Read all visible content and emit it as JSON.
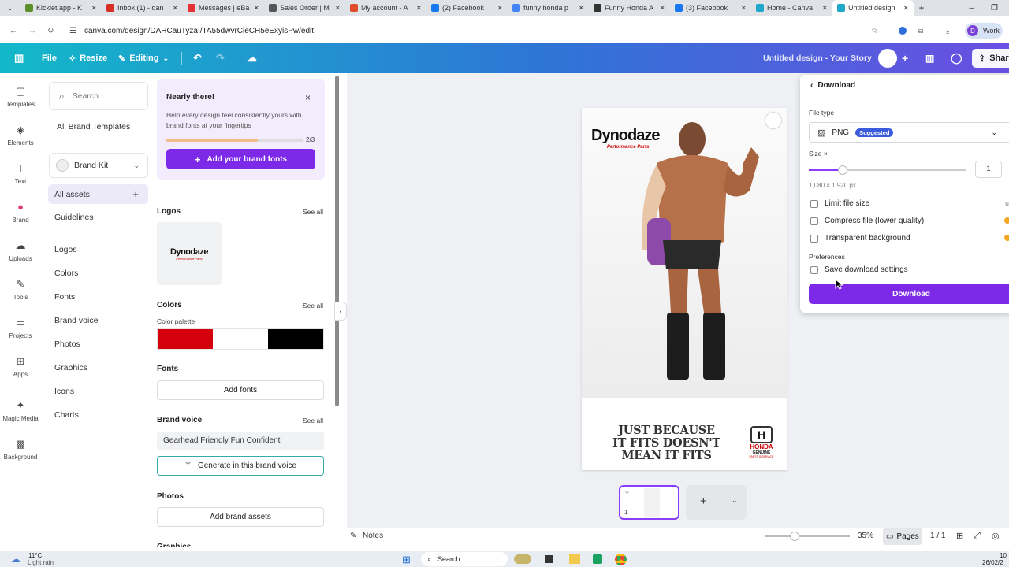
{
  "browser": {
    "tabs": [
      {
        "title": "Kicklet.app - K",
        "icon": "kicklet-icon",
        "color": "#5a8f2a"
      },
      {
        "title": "Inbox (1) - dan",
        "icon": "gmail-icon",
        "color": "#d93025"
      },
      {
        "title": "Messages | eBa",
        "icon": "ebay-icon",
        "color": "#e53238"
      },
      {
        "title": "Sales Order | M",
        "icon": "globe-icon",
        "color": "#555555"
      },
      {
        "title": "My account - A",
        "icon": "store-icon",
        "color": "#e04b2a"
      },
      {
        "title": "(2) Facebook",
        "icon": "facebook-icon",
        "color": "#1877f2"
      },
      {
        "title": "funny honda p",
        "icon": "google-icon",
        "color": "#4285f4"
      },
      {
        "title": "Funny Honda A",
        "icon": "honda-icon",
        "color": "#333333"
      },
      {
        "title": "(3) Facebook",
        "icon": "facebook-icon",
        "color": "#1877f2"
      },
      {
        "title": "Home - Canva",
        "icon": "canva-icon",
        "color": "#1ea7c9"
      },
      {
        "title": "Untitled design",
        "icon": "canva-icon",
        "color": "#1ea7c9"
      }
    ],
    "url": "canva.com/design/DAHCauTyzaI/TA55dwvrCieCH5eExyisPw/edit",
    "profile_label": "Work",
    "profile_initial": "D"
  },
  "header": {
    "file": "File",
    "resize": "Resize",
    "editing": "Editing",
    "design_title": "Untitled design - Your Story",
    "share": "Shar"
  },
  "rail": [
    {
      "label": "Templates",
      "icon": "templates-icon",
      "glyph": "▢"
    },
    {
      "label": "Elements",
      "icon": "elements-icon",
      "glyph": "◈"
    },
    {
      "label": "Text",
      "icon": "text-icon",
      "glyph": "T"
    },
    {
      "label": "Brand",
      "icon": "brand-icon",
      "glyph": "●"
    },
    {
      "label": "Uploads",
      "icon": "uploads-icon",
      "glyph": "☁"
    },
    {
      "label": "Tools",
      "icon": "tools-icon",
      "glyph": "✎"
    },
    {
      "label": "Projects",
      "icon": "projects-icon",
      "glyph": "▭"
    },
    {
      "label": "Apps",
      "icon": "apps-icon",
      "glyph": "⊞"
    },
    {
      "label": "Magic Media",
      "icon": "magic-media-icon",
      "glyph": "✦"
    },
    {
      "label": "Background",
      "icon": "background-icon",
      "glyph": "▩"
    }
  ],
  "brand_nav": {
    "search_placeholder": "Search",
    "all_templates": "All Brand Templates",
    "brand_kit": "Brand Kit",
    "all_assets": "All assets",
    "guidelines": "Guidelines",
    "items": [
      "Logos",
      "Colors",
      "Fonts",
      "Brand voice",
      "Photos",
      "Graphics",
      "Icons",
      "Charts"
    ]
  },
  "brand_panel": {
    "promo_title": "Nearly there!",
    "promo_body": "Help every design feel consistently yours with brand fonts at your fingertips",
    "promo_progress": "2/3",
    "promo_fraction": 0.667,
    "promo_button": "Add your brand fonts",
    "logos_title": "Logos",
    "see_all": "See all",
    "logo_text": "Dynodaze",
    "logo_sub": "Performance Parts",
    "colors_title": "Colors",
    "palette_label": "Color palette",
    "palette": [
      "#d4000b",
      "#ffffff",
      "#000000"
    ],
    "fonts_title": "Fonts",
    "add_fonts": "Add fonts",
    "voice_title": "Brand voice",
    "voice_text": "Gearhead Friendly Fun Confident",
    "generate": "Generate in this brand voice",
    "photos_title": "Photos",
    "add_assets": "Add brand assets",
    "graphics_title": "Graphics"
  },
  "canvas": {
    "brand": "Dynodaze",
    "brand_sub": "Performance Parts",
    "tagline": [
      "JUST BECAUSE",
      "IT FITS DOESN'T",
      "MEAN IT FITS"
    ],
    "honda": "HONDA",
    "honda_sub": "GENUINE",
    "honda_sub2": "PARTS & SERVICE",
    "page_number": "1"
  },
  "download": {
    "back": "Download",
    "file_type_label": "File type",
    "file_type": "PNG",
    "suggested": "Suggested",
    "size_label": "Size ×",
    "size_value": "1",
    "dims": "1,080 × 1,920 px",
    "limit": "Limit file size",
    "compress": "Compress file (lower quality)",
    "transparent": "Transparent background",
    "preferences": "Preferences",
    "save_settings": "Save download settings",
    "button": "Download"
  },
  "footer": {
    "notes": "Notes",
    "zoom": "35%",
    "pages": "Pages",
    "page_count": "1 / 1"
  },
  "taskbar": {
    "temp": "11°C",
    "weather": "Light rain",
    "search": "Search",
    "time": "10",
    "date": "26/02/2"
  }
}
